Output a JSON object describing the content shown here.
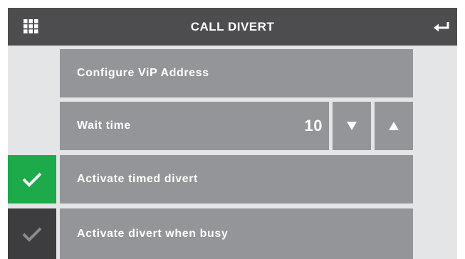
{
  "header": {
    "title": "CALL DIVERT",
    "menu_icon": "grid-icon",
    "back_icon": "return-arrow-icon"
  },
  "menu": {
    "configure_vip": {
      "label": "Configure ViP Address"
    },
    "wait_time": {
      "label": "Wait time",
      "value": "10",
      "decrease_icon": "triangle-down-icon",
      "increase_icon": "triangle-up-icon"
    },
    "timed_divert": {
      "label": "Activate timed divert",
      "checked": true
    },
    "divert_busy": {
      "label": "Activate divert when busy",
      "checked": false
    }
  },
  "colors": {
    "header_bg": "#4d4d4f",
    "row_bg": "#939598",
    "panel_bg": "#e4e5e6",
    "check_active": "#1daa4a",
    "check_inactive": "#3d3d3f"
  }
}
